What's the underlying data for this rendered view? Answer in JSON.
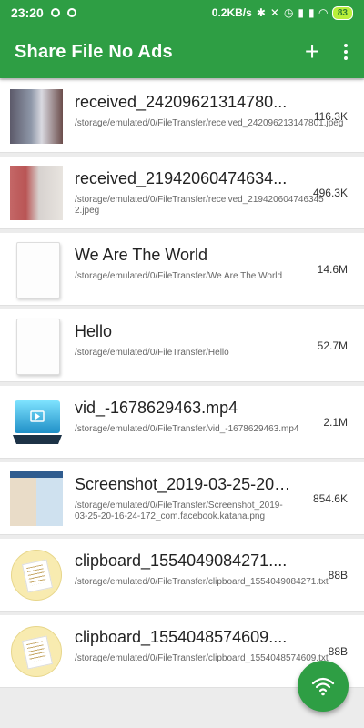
{
  "status_bar": {
    "time": "23:20",
    "network_speed": "0.2KB/s",
    "battery": "83",
    "icons": [
      "notification-dot-icon",
      "notification-dot-icon",
      "bluetooth-icon",
      "mute-icon",
      "alarm-icon",
      "signal-icon",
      "signal-icon",
      "wifi-icon"
    ]
  },
  "toolbar": {
    "title": "Share File No Ads",
    "add_icon": "plus-icon",
    "more_icon": "more-vert-icon"
  },
  "files": [
    {
      "name": "received_24209621314780...",
      "path": "/storage/emulated/0/FileTransfer/received_242096213147801.jpeg",
      "size": "116.3K",
      "thumb": "photo1"
    },
    {
      "name": "received_21942060474634...",
      "path": "/storage/emulated/0/FileTransfer/received_219420604746345 2.jpeg",
      "size": "496.3K",
      "thumb": "photo2"
    },
    {
      "name": "We Are The World",
      "path": "/storage/emulated/0/FileTransfer/We Are The World",
      "size": "14.6M",
      "thumb": "doc"
    },
    {
      "name": "Hello",
      "path": "/storage/emulated/0/FileTransfer/Hello",
      "size": "52.7M",
      "thumb": "doc"
    },
    {
      "name": "vid_-1678629463.mp4",
      "path": "/storage/emulated/0/FileTransfer/vid_-1678629463.mp4",
      "size": "2.1M",
      "thumb": "video"
    },
    {
      "name": "Screenshot_2019-03-25-20-...",
      "path": "/storage/emulated/0/FileTransfer/Screenshot_2019-03-25-20-16-24-172_com.facebook.katana.png",
      "size": "854.6K",
      "thumb": "screenshot"
    },
    {
      "name": "clipboard_1554049084271....",
      "path": "/storage/emulated/0/FileTransfer/clipboard_1554049084271.txt",
      "size": "88B",
      "thumb": "clipboard"
    },
    {
      "name": "clipboard_1554048574609....",
      "path": "/storage/emulated/0/FileTransfer/clipboard_1554048574609.txt",
      "size": "88B",
      "thumb": "clipboard"
    }
  ],
  "fab": {
    "icon": "wifi-share-icon"
  },
  "colors": {
    "primary": "#2e9e44",
    "battery": "#b9ef3a",
    "list_bg": "#ececec"
  }
}
